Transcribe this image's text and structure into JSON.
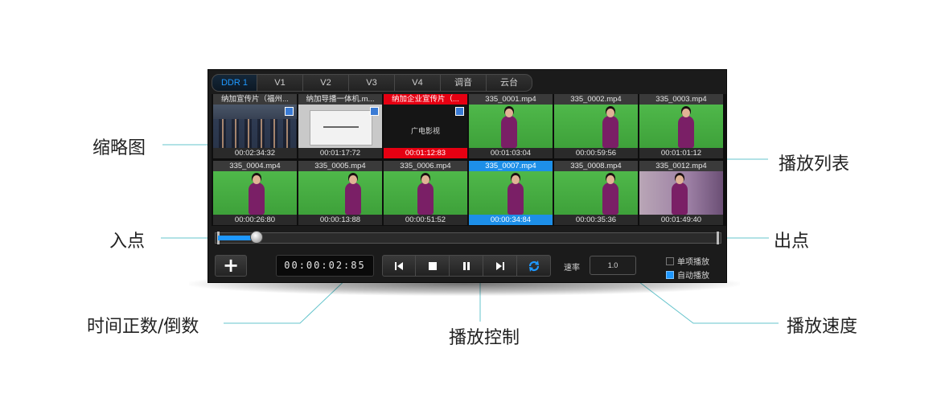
{
  "tabs": [
    {
      "label": "DDR 1",
      "active": true
    },
    {
      "label": "V1"
    },
    {
      "label": "V2"
    },
    {
      "label": "V3"
    },
    {
      "label": "V4"
    },
    {
      "label": "调音"
    },
    {
      "label": "云台"
    }
  ],
  "clips": [
    {
      "title": "纳加宣传片（福州...",
      "time": "00:02:34:32",
      "thumb": "crowd"
    },
    {
      "title": "纳加导播一体机.m...",
      "time": "00:01:17:72",
      "thumb": "white"
    },
    {
      "title": "纳加企业宣传片（...",
      "time": "00:01:12:83",
      "thumb": "black",
      "thumb_text": "广电影视",
      "state": "red"
    },
    {
      "title": "335_0001.mp4",
      "time": "00:01:03:04",
      "thumb": "green"
    },
    {
      "title": "335_0002.mp4",
      "time": "00:00:59:56",
      "thumb": "green"
    },
    {
      "title": "335_0003.mp4",
      "time": "00:01:01:12",
      "thumb": "green"
    },
    {
      "title": "335_0004.mp4",
      "time": "00:00:26:80",
      "thumb": "green"
    },
    {
      "title": "335_0005.mp4",
      "time": "00:00:13:88",
      "thumb": "green"
    },
    {
      "title": "335_0006.mp4",
      "time": "00:00:51:52",
      "thumb": "green"
    },
    {
      "title": "335_0007.mp4",
      "time": "00:00:34:84",
      "thumb": "green",
      "state": "blue"
    },
    {
      "title": "335_0008.mp4",
      "time": "00:00:35:36",
      "thumb": "green"
    },
    {
      "title": "335_0012.mp4",
      "time": "00:01:49:40",
      "thumb": "room"
    }
  ],
  "playback": {
    "progress": 0.05,
    "timecode": "00:00:02:85",
    "rate_label": "速率",
    "rate_value": "1.0",
    "modes": [
      {
        "label": "单项播放",
        "checked": false
      },
      {
        "label": "自动播放",
        "checked": true
      }
    ]
  },
  "transport": {
    "buttons": [
      "skip-start-icon",
      "stop-icon",
      "pause-icon",
      "skip-end-icon",
      "loop-icon"
    ]
  },
  "callouts": {
    "thumbnail": "缩略图",
    "playlist": "播放列表",
    "in_point": "入点",
    "out_point": "出点",
    "timecode": "时间正数/倒数",
    "playback_control": "播放控制",
    "playback_speed": "播放速度"
  },
  "colors": {
    "accent": "#1e98ff",
    "selected_red": "#e60012",
    "leader_line": "#66c4cc"
  }
}
